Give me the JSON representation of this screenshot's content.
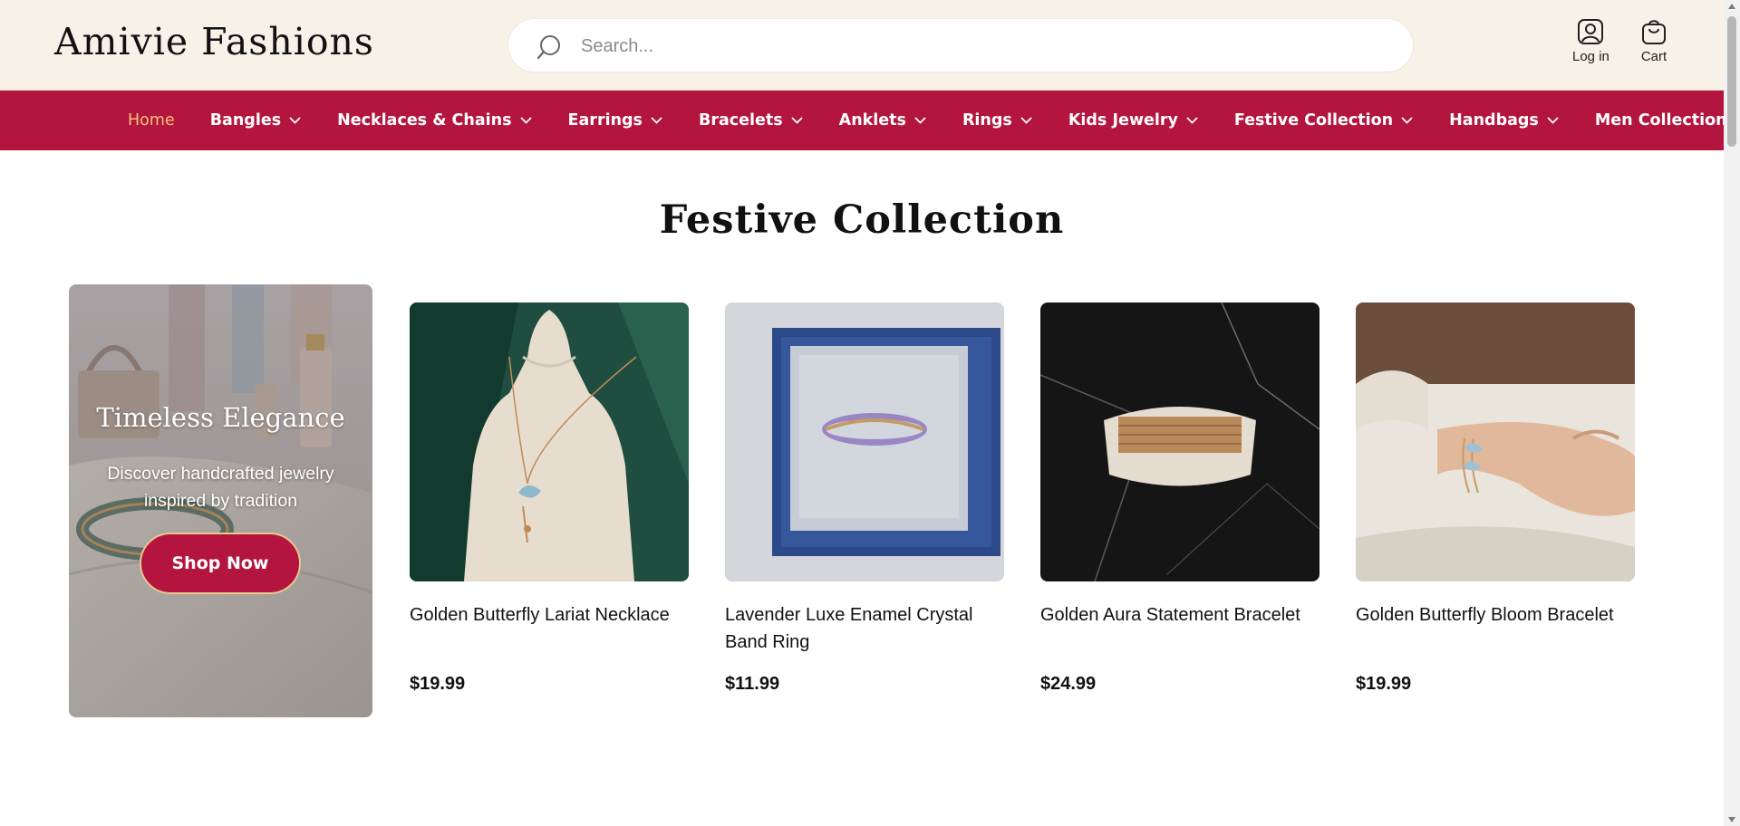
{
  "header": {
    "logo": "Amivie Fashions",
    "search_placeholder": "Search...",
    "login_label": "Log in",
    "cart_label": "Cart"
  },
  "nav": {
    "items": [
      {
        "label": "Home",
        "active": true,
        "dropdown": false
      },
      {
        "label": "Bangles",
        "dropdown": true
      },
      {
        "label": "Necklaces & Chains",
        "dropdown": true
      },
      {
        "label": "Earrings",
        "dropdown": true
      },
      {
        "label": "Bracelets",
        "dropdown": true
      },
      {
        "label": "Anklets",
        "dropdown": true
      },
      {
        "label": "Rings",
        "dropdown": true
      },
      {
        "label": "Kids Jewelry",
        "dropdown": true
      },
      {
        "label": "Festive Collection",
        "dropdown": true
      },
      {
        "label": "Handbags",
        "dropdown": true
      },
      {
        "label": "Men Collection",
        "dropdown": false
      }
    ]
  },
  "section": {
    "title": "Festive Collection"
  },
  "promo": {
    "title": "Timeless Elegance",
    "subtitle": "Discover handcrafted jewelry inspired by tradition",
    "button": "Shop Now"
  },
  "products": [
    {
      "name": "Golden Butterfly Lariat Necklace",
      "price": "$19.99"
    },
    {
      "name": "Lavender Luxe Enamel Crystal Band Ring",
      "price": "$11.99"
    },
    {
      "name": "Golden Aura Statement Bracelet",
      "price": "$24.99"
    },
    {
      "name": "Golden Butterfly Bloom Bracelet",
      "price": "$19.99"
    }
  ],
  "colors": {
    "brand": "#b3153f",
    "header_bg": "#f8f1e7",
    "active_nav": "#f3c37a",
    "button_border": "#e9c78b"
  },
  "icons": {
    "search": "search-icon",
    "login": "user-icon",
    "cart": "shopping-bag-icon",
    "dropdown": "chevron-down-icon"
  }
}
